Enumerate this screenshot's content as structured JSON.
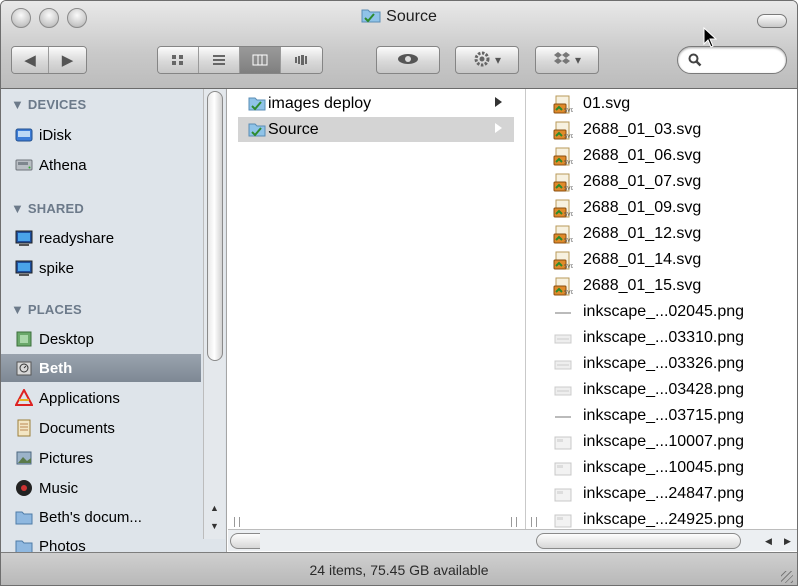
{
  "window": {
    "title": "Source"
  },
  "toolbar": {
    "back_label": "◀",
    "forward_label": "▶",
    "view_icon": "▮▮▮",
    "quicklook_icon": "eye-icon",
    "action_icon": "gear-icon",
    "dropbox_icon": "dropbox-icon",
    "search_placeholder": ""
  },
  "sidebar": {
    "sections": [
      {
        "title": "▼ DEVICES",
        "items": [
          {
            "label": "iDisk",
            "icon": "idisk-icon"
          },
          {
            "label": "Athena",
            "icon": "harddisk-icon"
          }
        ]
      },
      {
        "title": "▼ SHARED",
        "items": [
          {
            "label": "readyshare",
            "icon": "server-icon"
          },
          {
            "label": "spike",
            "icon": "server-icon"
          }
        ]
      },
      {
        "title": "▼ PLACES",
        "items": [
          {
            "label": "Desktop",
            "icon": "desktop-icon"
          },
          {
            "label": "Beth",
            "icon": "home-icon",
            "selected": true
          },
          {
            "label": "Applications",
            "icon": "applications-icon"
          },
          {
            "label": "Documents",
            "icon": "documents-icon"
          },
          {
            "label": "Pictures",
            "icon": "pictures-icon"
          },
          {
            "label": "Music",
            "icon": "music-icon"
          },
          {
            "label": "Beth's docum...",
            "icon": "folder-icon"
          },
          {
            "label": "Photos",
            "icon": "folder-icon"
          }
        ]
      }
    ]
  },
  "column1": {
    "items": [
      {
        "label": "images deploy",
        "selected": false
      },
      {
        "label": "Source",
        "selected": true
      }
    ]
  },
  "column2": {
    "items": [
      {
        "label": "01.svg",
        "type": "svg"
      },
      {
        "label": "2688_01_03.svg",
        "type": "svg"
      },
      {
        "label": "2688_01_06.svg",
        "type": "svg"
      },
      {
        "label": "2688_01_07.svg",
        "type": "svg"
      },
      {
        "label": "2688_01_09.svg",
        "type": "svg"
      },
      {
        "label": "2688_01_12.svg",
        "type": "svg"
      },
      {
        "label": "2688_01_14.svg",
        "type": "svg"
      },
      {
        "label": "2688_01_15.svg",
        "type": "svg"
      },
      {
        "label": "inkscape_...02045.png",
        "type": "png-line"
      },
      {
        "label": "inkscape_...03310.png",
        "type": "png-thumb"
      },
      {
        "label": "inkscape_...03326.png",
        "type": "png-thumb"
      },
      {
        "label": "inkscape_...03428.png",
        "type": "png-thumb"
      },
      {
        "label": "inkscape_...03715.png",
        "type": "png-line"
      },
      {
        "label": "inkscape_...10007.png",
        "type": "png-box"
      },
      {
        "label": "inkscape_...10045.png",
        "type": "png-box"
      },
      {
        "label": "inkscape_...24847.png",
        "type": "png-box"
      },
      {
        "label": "inkscape_...24925.png",
        "type": "png-box"
      }
    ]
  },
  "status": {
    "text": "24 items, 75.45 GB available"
  },
  "colors": {
    "sidebar_bg": "#dee4ea",
    "selection": "#d4d4d4",
    "sidebar_head": "#6c7a8a"
  }
}
